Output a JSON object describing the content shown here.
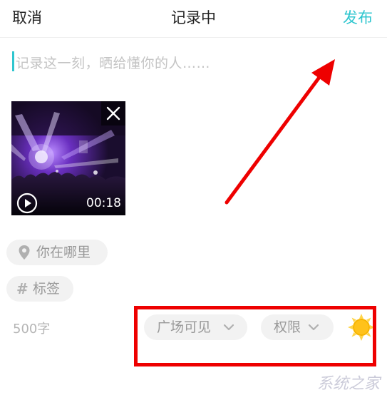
{
  "header": {
    "cancel_label": "取消",
    "title": "记录中",
    "publish_label": "发布"
  },
  "editor": {
    "placeholder": "记录这一刻，晒给懂你的人……"
  },
  "video": {
    "duration": "00:18"
  },
  "chips": {
    "location_label": "你在哪里",
    "tag_label": "标签",
    "visibility_label": "广场可见",
    "permission_label": "权限"
  },
  "footer": {
    "word_count": "500字"
  },
  "colors": {
    "accent": "#2fc6cf",
    "annotation": "#ee0000",
    "sun": "#f7b500"
  },
  "icons": {
    "location": "location-pin-icon",
    "tag": "hash-icon",
    "close": "close-icon",
    "play": "play-icon",
    "chevron": "chevron-down-icon",
    "sun": "sun-icon"
  }
}
